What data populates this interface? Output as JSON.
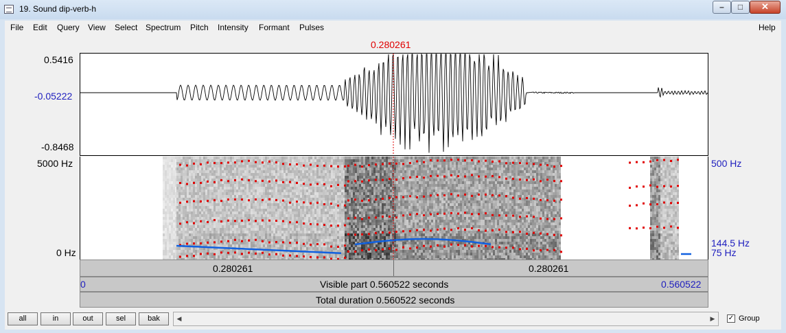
{
  "window": {
    "title": "19. Sound dip-verb-h",
    "min_glyph": "–",
    "max_glyph": "□",
    "close_glyph": "✕"
  },
  "menu": [
    "File",
    "Edit",
    "Query",
    "View",
    "Select",
    "Spectrum",
    "Pitch",
    "Intensity",
    "Formant",
    "Pulses"
  ],
  "help_label": "Help",
  "cursor": {
    "time_label": "0.280261",
    "time_fraction": 0.5,
    "color": "#e00000"
  },
  "waveform": {
    "y_max_label": "0.5416",
    "y_mid_label": "-0.05222",
    "y_min_label": "-0.8468"
  },
  "spectrogram": {
    "freq_max_label": "5000 Hz",
    "freq_min_label": "0 Hz",
    "pitch_top_label": "500 Hz",
    "pitch_value_label": "144.5 Hz",
    "pitch_bottom_label": "75 Hz",
    "formant_color": "#e00000",
    "pitch_color": "#1060e0"
  },
  "selection_bar": {
    "left_label": "0.280261",
    "right_label": "0.280261"
  },
  "visible_bar": {
    "start_label": "0",
    "text": "Visible part 0.560522 seconds",
    "end_label": "0.560522"
  },
  "total_bar": {
    "text": "Total duration 0.560522 seconds"
  },
  "buttons": {
    "all": "all",
    "in": "in",
    "out": "out",
    "sel": "sel",
    "bak": "bak"
  },
  "scroll": {
    "left_glyph": "◀",
    "right_glyph": "▶"
  },
  "group": {
    "label": "Group",
    "checked_glyph": "✓"
  }
}
